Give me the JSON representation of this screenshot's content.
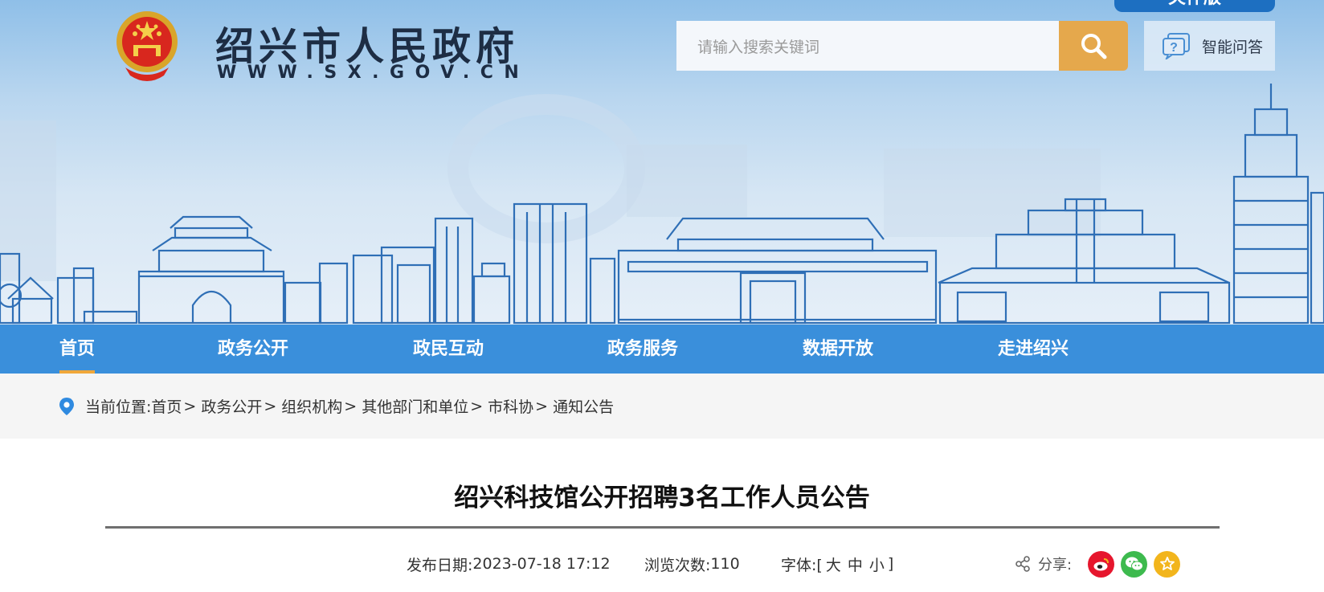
{
  "header": {
    "site_name": "绍兴市人民政府",
    "site_url": "WWW.SX.GOV.CN",
    "elder_tab_label": "关怀版",
    "search": {
      "placeholder": "请输入搜索关键词"
    },
    "qa_label": "智能问答"
  },
  "nav": {
    "items": [
      {
        "label": "首页",
        "active": true
      },
      {
        "label": "政务公开"
      },
      {
        "label": "政民互动"
      },
      {
        "label": "政务服务"
      },
      {
        "label": "数据开放"
      },
      {
        "label": "走进绍兴"
      }
    ]
  },
  "breadcrumb": {
    "prefix": "当前位置:",
    "items": [
      "首页",
      "政务公开",
      "组织机构",
      "其他部门和单位",
      "市科协",
      "通知公告"
    ],
    "separator": ">"
  },
  "article": {
    "title": "绍兴科技馆公开招聘3名工作人员公告",
    "publish_label": "发布日期:",
    "publish_date": "2023-07-18 17:12",
    "views_label": "浏览次数:",
    "views": "110",
    "font_label": "字体:[",
    "font_large": "大",
    "font_medium": "中",
    "font_small": "小",
    "font_close": "]",
    "share_label": "分享:"
  },
  "colors": {
    "nav_bg": "#3a8fdb",
    "nav_active_underline": "#f0a73a",
    "search_button": "#e5a84c",
    "weibo": "#e6162d",
    "wechat": "#3dba4e",
    "favorite": "#f2b51c"
  },
  "icons": {
    "emblem": "national-emblem",
    "search": "search-icon",
    "qa": "question-chat-icon",
    "location": "location-pin-icon",
    "share": "share-icon",
    "weibo": "weibo-icon",
    "wechat": "wechat-icon",
    "favorite": "star-icon"
  }
}
